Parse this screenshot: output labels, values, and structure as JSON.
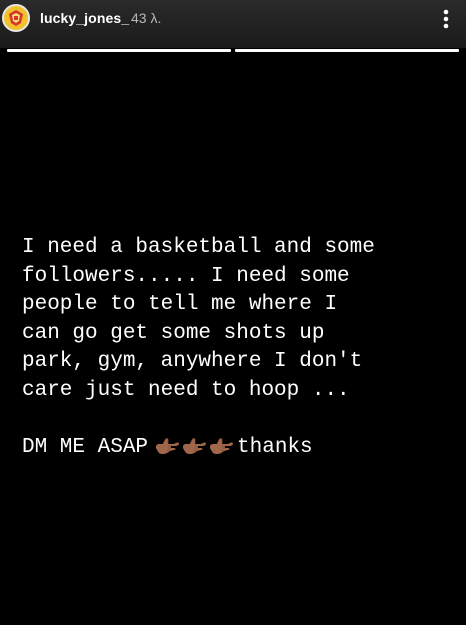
{
  "story": {
    "header": {
      "username": "lucky_jones_",
      "timestamp": "43 λ.",
      "avatar_icon": "avatar-icon",
      "more_icon": "more-vertical-icon"
    },
    "progress": {
      "segments": [
        1,
        1
      ],
      "active_segment": 2
    },
    "text_lines": [
      "I need a basketball and some",
      "followers..... I need some",
      "people to tell me where I",
      "can go get some shots up",
      "park, gym, anywhere I don't",
      "care just need to hoop ..."
    ],
    "cta_text": "DM ME ASAP",
    "cta_suffix": "thanks",
    "emoji": {
      "name": "call-me-hand-icon",
      "count": 3,
      "skin_color": "#a0674b"
    },
    "colors": {
      "background": "#000000",
      "text": "#ffffff",
      "header_bg": "#1b1b1b"
    }
  }
}
